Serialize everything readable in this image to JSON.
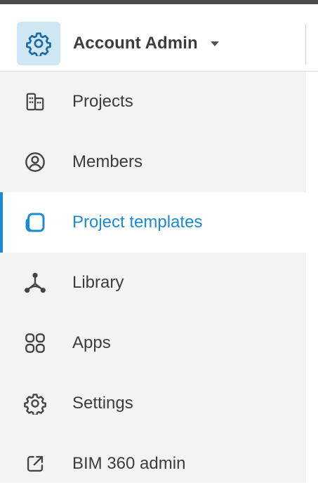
{
  "header": {
    "app_title": "Account Admin",
    "app_icon": "gear-icon",
    "dropdown_icon": "caret-down-icon"
  },
  "colors": {
    "accent": "#1a8ad4",
    "icon_tile_bg": "#cfe6f3",
    "nav_bg": "#f3f3f3",
    "text": "#3c3c3c"
  },
  "nav": {
    "active_item": "Project templates",
    "items": [
      {
        "label": "Projects",
        "icon": "building-icon"
      },
      {
        "label": "Members",
        "icon": "user-circle-icon"
      },
      {
        "label": "Project templates",
        "icon": "document-copy-icon"
      },
      {
        "label": "Library",
        "icon": "network-node-icon"
      },
      {
        "label": "Apps",
        "icon": "apps-grid-icon"
      },
      {
        "label": "Settings",
        "icon": "gear-icon"
      },
      {
        "label": "BIM 360 admin",
        "icon": "external-link-icon"
      }
    ]
  }
}
